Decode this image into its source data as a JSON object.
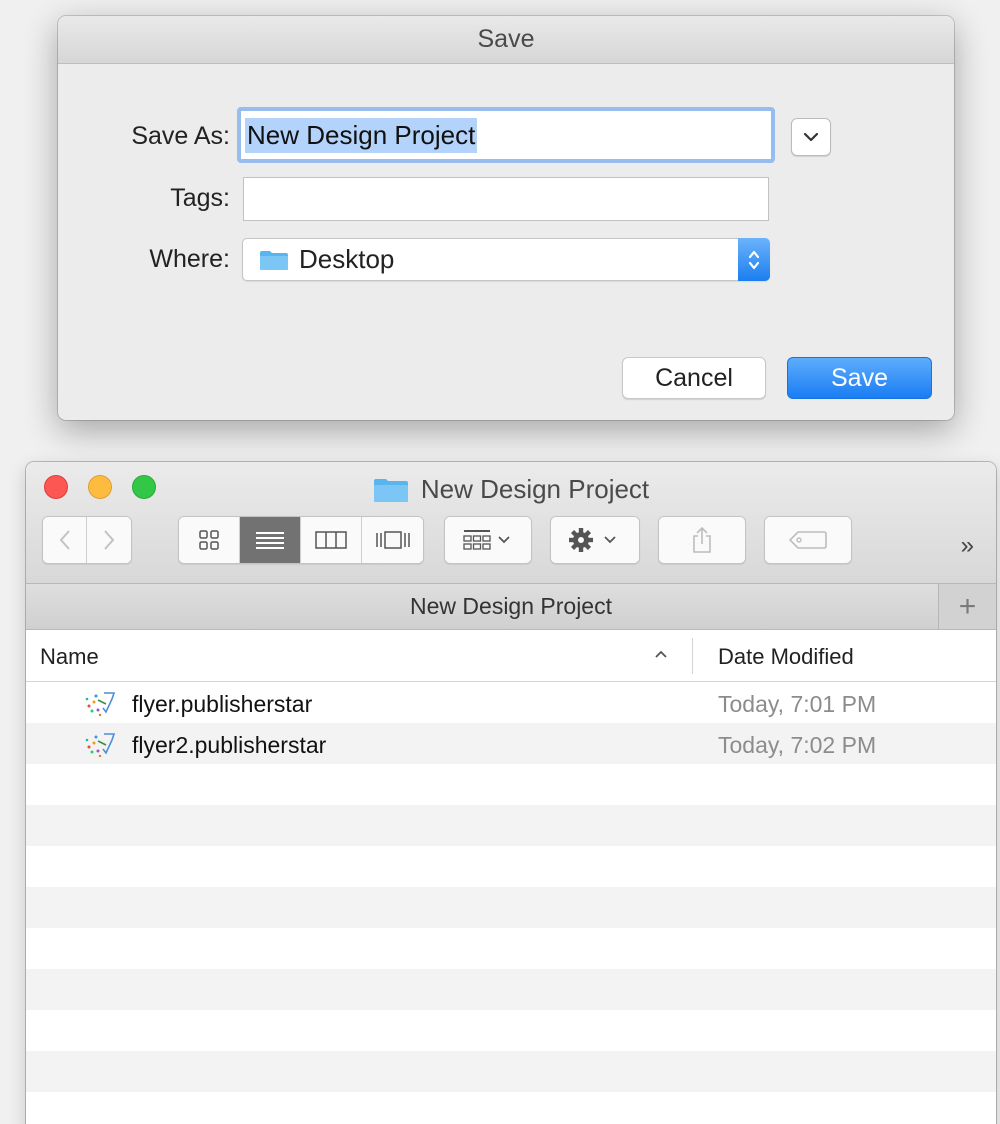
{
  "save_dialog": {
    "title": "Save",
    "save_as_label": "Save As:",
    "save_as_value": "New Design Project",
    "tags_label": "Tags:",
    "tags_value": "",
    "where_label": "Where:",
    "where_value": "Desktop",
    "cancel_label": "Cancel",
    "save_label": "Save",
    "accent_color": "#1a7df4"
  },
  "finder": {
    "window_title": "New Design Project",
    "tab_title": "New Design Project",
    "new_tab_label": "+",
    "more_label": "»",
    "columns": {
      "name": "Name",
      "date_modified": "Date Modified"
    },
    "files": [
      {
        "name": "flyer.publisherstar",
        "date": "Today, 7:01 PM",
        "icon": "publisherstar-file-icon"
      },
      {
        "name": "flyer2.publisherstar",
        "date": "Today, 7:02 PM",
        "icon": "publisherstar-file-icon"
      }
    ],
    "traffic_lights": {
      "close": "#fc5753",
      "minimize": "#fdbc40",
      "zoom": "#33c748"
    }
  }
}
